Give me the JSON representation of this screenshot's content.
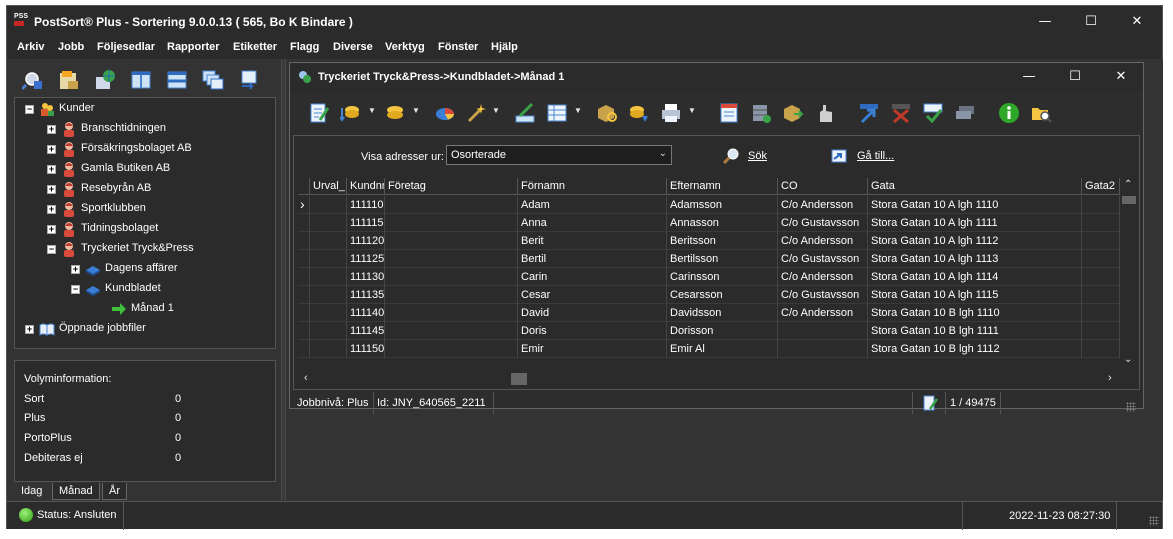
{
  "window": {
    "title": "PostSort® Plus - Sortering 9.0.0.13 ( 565, Bo K Bindare )",
    "icon_text": "PSS",
    "minimize": "—",
    "maximize": "☐",
    "close": "✕"
  },
  "menu": [
    "Arkiv",
    "Jobb",
    "Följesedlar",
    "Rapporter",
    "Etiketter",
    "Flagg",
    "Diverse",
    "Verktyg",
    "Fönster",
    "Hjälp"
  ],
  "left_toolbar": [
    "search-tree-icon",
    "new-job-icon",
    "database-globe-icon",
    "split-vertical-icon",
    "split-horizontal-icon",
    "windows-cascade-icon",
    "refresh-icon"
  ],
  "tree": {
    "root": "Kunder",
    "customers": [
      "Branschtidningen",
      "Försäkringsbolaget AB",
      "Gamla Butiken AB",
      "Resebyrån AB",
      "Sportklubben",
      "Tidningsbolaget",
      "Tryckeriet Tryck&Press"
    ],
    "jobs": [
      "Dagens affärer",
      "Kundbladet"
    ],
    "subjob": "Månad 1",
    "opened": "Öppnade jobbfiler"
  },
  "volume": {
    "heading": "Volyminformation:",
    "rows": [
      {
        "label": "Sort",
        "value": "0"
      },
      {
        "label": "Plus",
        "value": "0"
      },
      {
        "label": "PortoPlus",
        "value": "0"
      },
      {
        "label": "Debiteras ej",
        "value": "0"
      }
    ],
    "tabs": [
      "Idag",
      "Månad",
      "År"
    ]
  },
  "child": {
    "title": "Tryckeriet Tryck&Press->Kundbladet->Månad 1",
    "filter_label": "Visa adresser ur:",
    "filter_value": "Osorterade",
    "search_label": "Sök",
    "goto_label": "Gå till..."
  },
  "grid": {
    "headers": [
      "Urval_",
      "Kundnr",
      "Företag",
      "Förnamn",
      "Efternamn",
      "CO",
      "Gata",
      "Gata2"
    ],
    "rows": [
      [
        "111110",
        "",
        "Adam",
        "Adamsson",
        "C/o Andersson",
        "Stora Gatan 10 A lgh 1110"
      ],
      [
        "111115",
        "",
        "Anna",
        "Annasson",
        "C/o Gustavsson",
        "Stora Gatan 10 A lgh 1111"
      ],
      [
        "111120",
        "",
        "Berit",
        "Beritsson",
        "C/o Andersson",
        "Stora Gatan 10 A lgh 1112"
      ],
      [
        "111125",
        "",
        "Bertil",
        "Bertilsson",
        "C/o Gustavsson",
        "Stora Gatan 10 A lgh 1113"
      ],
      [
        "111130",
        "",
        "Carin",
        "Carinsson",
        "C/o Andersson",
        "Stora Gatan 10 A lgh 1114"
      ],
      [
        "111135",
        "",
        "Cesar",
        "Cesarsson",
        "C/o Gustavsson",
        "Stora Gatan 10 A lgh 1115"
      ],
      [
        "111140",
        "",
        "David",
        "Davidsson",
        "C/o Andersson",
        "Stora Gatan 10 B lgh 1110"
      ],
      [
        "111145",
        "",
        "Doris",
        "Dorisson",
        "",
        "Stora Gatan 10 B lgh 1111"
      ],
      [
        "111150",
        "",
        "Emir",
        "Emir Al",
        "",
        "Stora Gatan 10 B lgh 1112"
      ]
    ]
  },
  "child_status": {
    "level": "Jobbnivå: Plus",
    "id": "Id: JNY_640565_2211",
    "count": "1 / 49475"
  },
  "statusbar": {
    "status": "Status: Ansluten",
    "datetime": "2022-11-23 08:27:30"
  },
  "colors": {
    "background": "#333333",
    "panel": "#2b2b2b",
    "text": "#ffffff",
    "accent_green": "#2d9c12"
  }
}
